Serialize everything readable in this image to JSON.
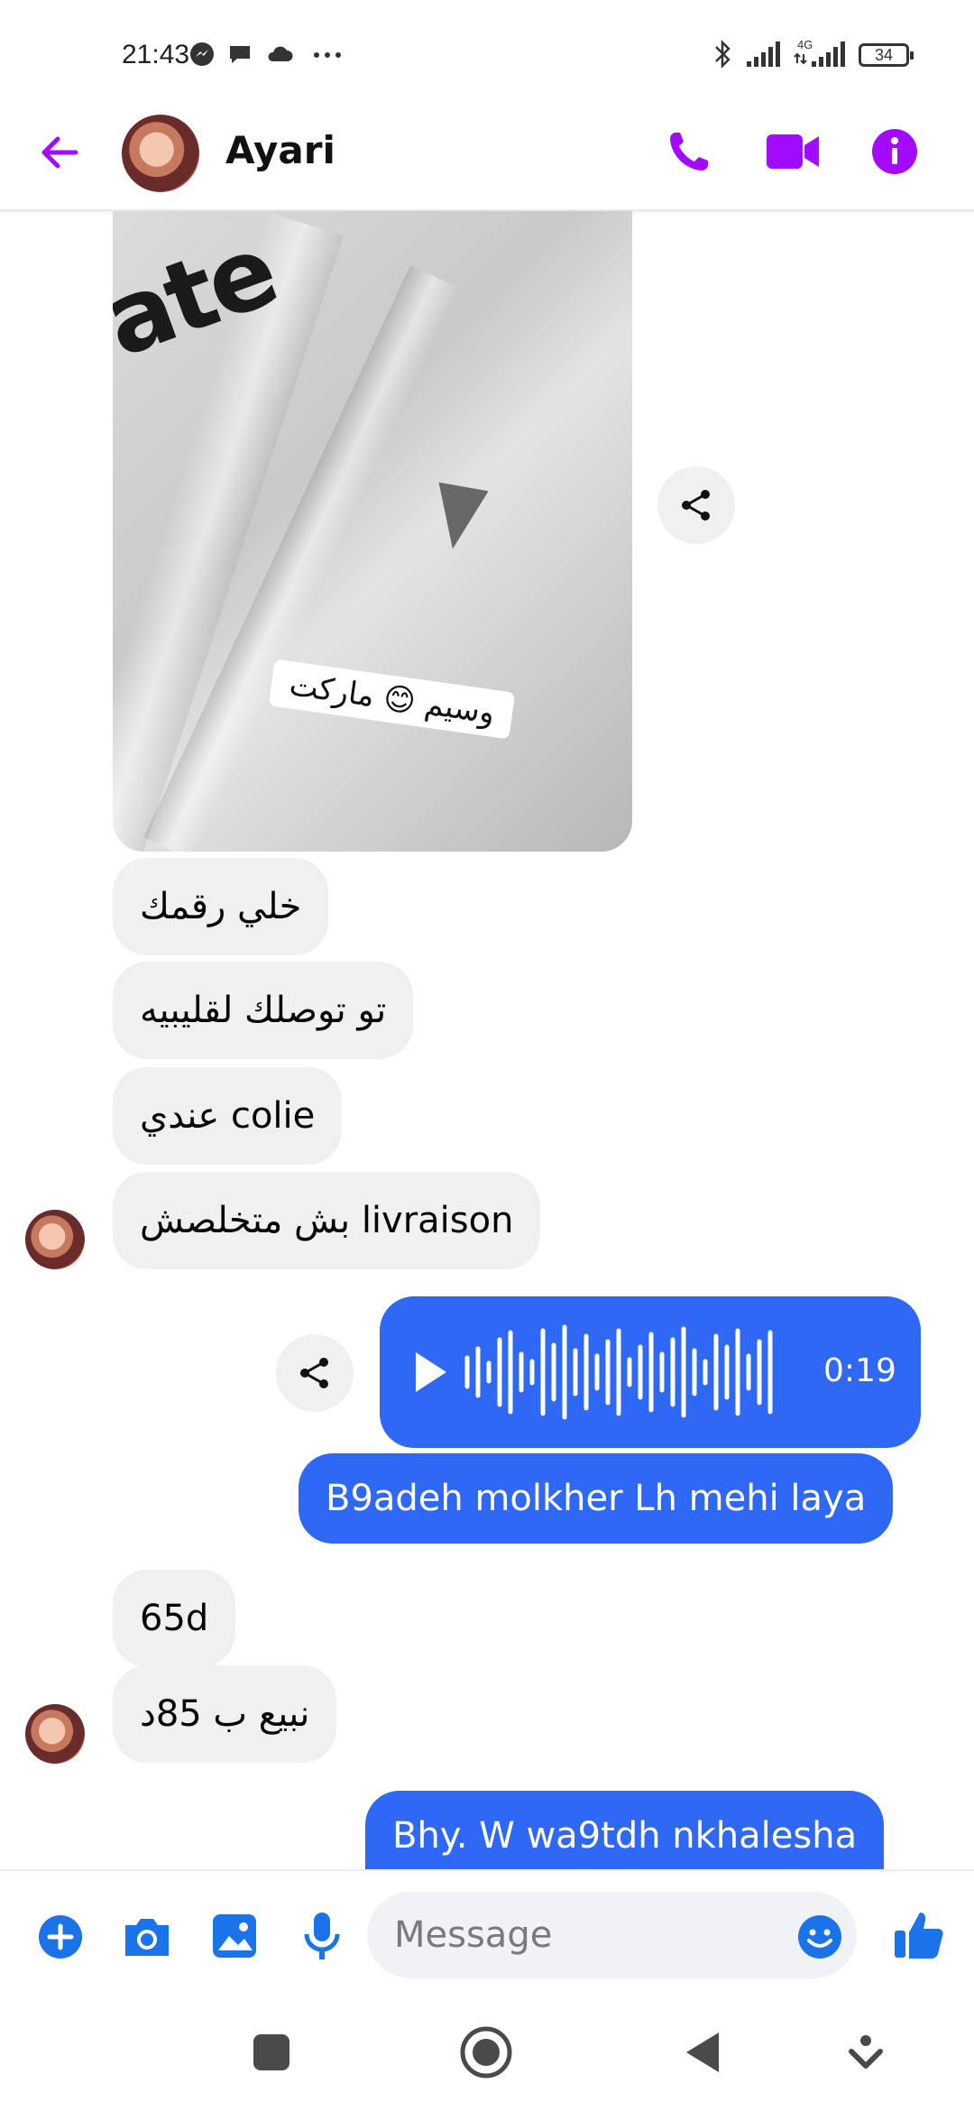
{
  "status_bar": {
    "time": "21:43",
    "notification_icons": [
      "messenger-icon",
      "chat-icon",
      "cloud-icon",
      "more-dots-icon"
    ],
    "network_label": "4G",
    "battery": "34"
  },
  "header": {
    "contact_name": "Ayari",
    "icons": [
      "back-arrow-icon",
      "phone-icon",
      "video-icon",
      "info-icon"
    ],
    "accent_color": "#a20bff"
  },
  "photo": {
    "shirt_print": "ate",
    "watermark": "وسيم 😊 ماركت"
  },
  "messages": {
    "incoming_1": "خلي رقمك",
    "incoming_2": "تو توصلك لقليبيه",
    "incoming_3": "colie عندي",
    "incoming_4": "livraison بش متخلصش",
    "voice_duration": "0:19",
    "outgoing_1": "B9adeh molkher Lh mehi laya",
    "incoming_5": "65d",
    "incoming_6": "نبيع ب 85د",
    "outgoing_2": "Bhy. W wa9tdh nkhalesha"
  },
  "composer": {
    "placeholder": "Message",
    "icons": [
      "plus-icon",
      "camera-icon",
      "gallery-icon",
      "microphone-icon",
      "emoji-icon",
      "like-icon"
    ]
  },
  "colors": {
    "outgoing_bubble": "#2e68f5",
    "incoming_bubble": "#f0f0f0",
    "toolbar_blue": "#1a73e8"
  }
}
